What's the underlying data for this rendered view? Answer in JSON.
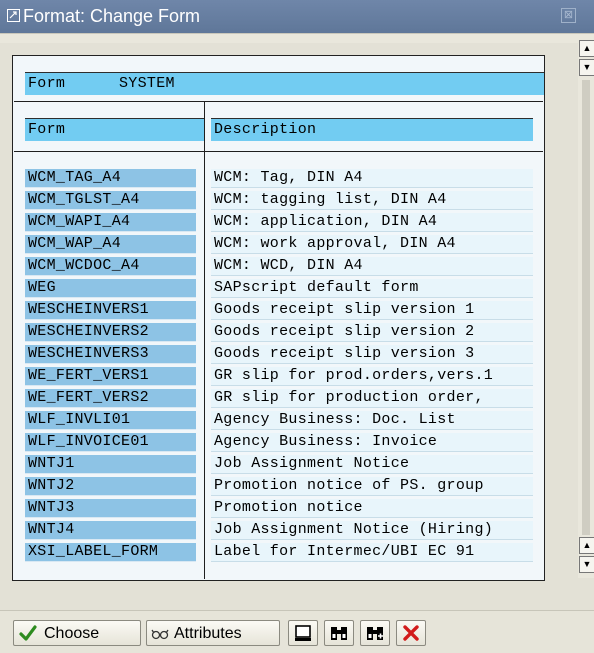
{
  "window": {
    "title": "Format: Change Form",
    "close_glyph": "⊠"
  },
  "table": {
    "filter_label": "Form",
    "filter_value": "SYSTEM",
    "col_form": "Form",
    "col_description": "Description",
    "rows": [
      {
        "form": "WCM_TAG_A4",
        "description": "WCM: Tag, DIN A4"
      },
      {
        "form": "WCM_TGLST_A4",
        "description": "WCM: tagging list, DIN A4"
      },
      {
        "form": "WCM_WAPI_A4",
        "description": "WCM: application, DIN A4"
      },
      {
        "form": "WCM_WAP_A4",
        "description": "WCM: work approval, DIN A4"
      },
      {
        "form": "WCM_WCDOC_A4",
        "description": "WCM: WCD, DIN A4"
      },
      {
        "form": "WEG",
        "description": "SAPscript default form"
      },
      {
        "form": "WESCHEINVERS1",
        "description": "Goods receipt slip version 1"
      },
      {
        "form": "WESCHEINVERS2",
        "description": "Goods receipt slip version 2"
      },
      {
        "form": "WESCHEINVERS3",
        "description": "Goods receipt slip version 3"
      },
      {
        "form": "WE_FERT_VERS1",
        "description": "GR slip for prod.orders,vers.1"
      },
      {
        "form": "WE_FERT_VERS2",
        "description": "GR slip for production order,"
      },
      {
        "form": "WLF_INVLI01",
        "description": "Agency Business: Doc. List"
      },
      {
        "form": "WLF_INVOICE01",
        "description": "Agency Business: Invoice"
      },
      {
        "form": "WNTJ1",
        "description": "Job Assignment Notice"
      },
      {
        "form": "WNTJ2",
        "description": "Promotion notice of PS. group"
      },
      {
        "form": "WNTJ3",
        "description": "Promotion notice"
      },
      {
        "form": "WNTJ4",
        "description": "Job Assignment Notice (Hiring)"
      },
      {
        "form": "XSI_LABEL_FORM",
        "description": "Label for Intermec/UBI EC 91"
      }
    ]
  },
  "toolbar": {
    "choose_label": "Choose",
    "attributes_label": "Attributes"
  },
  "colors": {
    "header_band": "#72ccf2",
    "form_cell": "#8dc3e5",
    "desc_cell": "#e8f5fb",
    "titlebar": "#6a81a3"
  }
}
